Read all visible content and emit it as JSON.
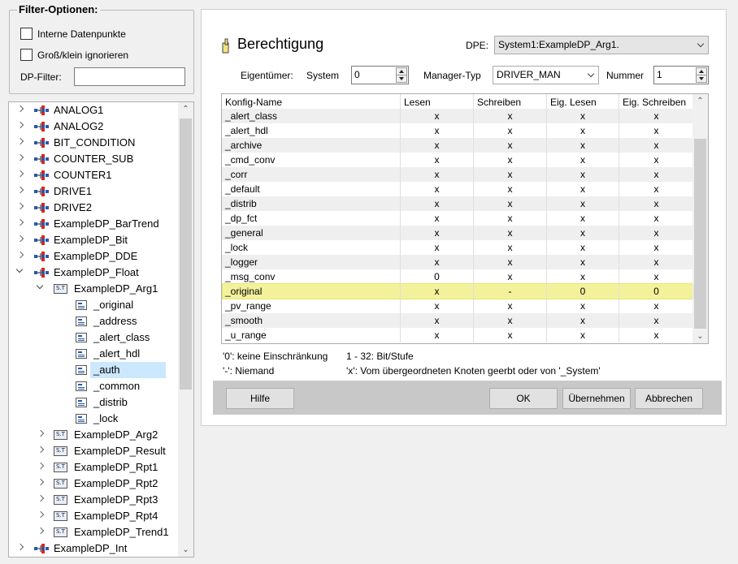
{
  "filter": {
    "title": "Filter-Optionen:",
    "internal_label": "Interne Datenpunkte",
    "case_label": "Groß/klein ignorieren",
    "dp_filter_label": "DP-Filter:",
    "dp_filter_value": ""
  },
  "tree": {
    "items": [
      {
        "label": "ANALOG1"
      },
      {
        "label": "ANALOG2"
      },
      {
        "label": "BIT_CONDITION"
      },
      {
        "label": "COUNTER_SUB"
      },
      {
        "label": "COUNTER1"
      },
      {
        "label": "DRIVE1"
      },
      {
        "label": "DRIVE2"
      },
      {
        "label": "ExampleDP_BarTrend"
      },
      {
        "label": "ExampleDP_Bit"
      },
      {
        "label": "ExampleDP_DDE"
      },
      {
        "label": "ExampleDP_Float"
      },
      {
        "label": "ExampleDP_Arg1"
      },
      {
        "label": "_original"
      },
      {
        "label": "_address"
      },
      {
        "label": "_alert_class"
      },
      {
        "label": "_alert_hdl"
      },
      {
        "label": "_auth"
      },
      {
        "label": "_common"
      },
      {
        "label": "_distrib"
      },
      {
        "label": "_lock"
      },
      {
        "label": "ExampleDP_Arg2"
      },
      {
        "label": "ExampleDP_Result"
      },
      {
        "label": "ExampleDP_Rpt1"
      },
      {
        "label": "ExampleDP_Rpt2"
      },
      {
        "label": "ExampleDP_Rpt3"
      },
      {
        "label": "ExampleDP_Rpt4"
      },
      {
        "label": "ExampleDP_Trend1"
      },
      {
        "label": "ExampleDP_Int"
      }
    ],
    "struct_icon_text": "S.T"
  },
  "panel": {
    "title": "Berechtigung",
    "dpe_label": "DPE:",
    "dpe_value": "System1:ExampleDP_Arg1.",
    "owner_label": "Eigentümer:",
    "system_label": "System",
    "system_value": "0",
    "manager_label": "Manager-Typ",
    "manager_value": "DRIVER_MAN",
    "number_label": "Nummer",
    "number_value": "1"
  },
  "table": {
    "headers": [
      "Konfig-Name",
      "Lesen",
      "Schreiben",
      "Eig. Lesen",
      "Eig. Schreiben"
    ],
    "rows": [
      [
        "_alert_class",
        "x",
        "x",
        "x",
        "x"
      ],
      [
        "_alert_hdl",
        "x",
        "x",
        "x",
        "x"
      ],
      [
        "_archive",
        "x",
        "x",
        "x",
        "x"
      ],
      [
        "_cmd_conv",
        "x",
        "x",
        "x",
        "x"
      ],
      [
        "_corr",
        "x",
        "x",
        "x",
        "x"
      ],
      [
        "_default",
        "x",
        "x",
        "x",
        "x"
      ],
      [
        "_distrib",
        "x",
        "x",
        "x",
        "x"
      ],
      [
        "_dp_fct",
        "x",
        "x",
        "x",
        "x"
      ],
      [
        "_general",
        "x",
        "x",
        "x",
        "x"
      ],
      [
        "_lock",
        "x",
        "x",
        "x",
        "x"
      ],
      [
        "_logger",
        "x",
        "x",
        "x",
        "x"
      ],
      [
        "_msg_conv",
        "0",
        "x",
        "x",
        "x"
      ],
      [
        "_original",
        "x",
        "-",
        "0",
        "0"
      ],
      [
        "_pv_range",
        "x",
        "x",
        "x",
        "x"
      ],
      [
        "_smooth",
        "x",
        "x",
        "x",
        "x"
      ],
      [
        "_u_range",
        "x",
        "x",
        "x",
        "x"
      ]
    ]
  },
  "legend": {
    "zero": "'0': keine Einschränkung",
    "range": "1 - 32: Bit/Stufe",
    "dash": "'-': Niemand",
    "x": "'x': Vom übergeordneten Knoten geerbt oder von '_System'"
  },
  "buttons": {
    "help": "Hilfe",
    "ok": "OK",
    "apply": "Übernehmen",
    "cancel": "Abbrechen"
  },
  "colors": {
    "highlight": "#f2f08a",
    "selection": "#cce8ff",
    "footer": "#c8c8c8"
  }
}
